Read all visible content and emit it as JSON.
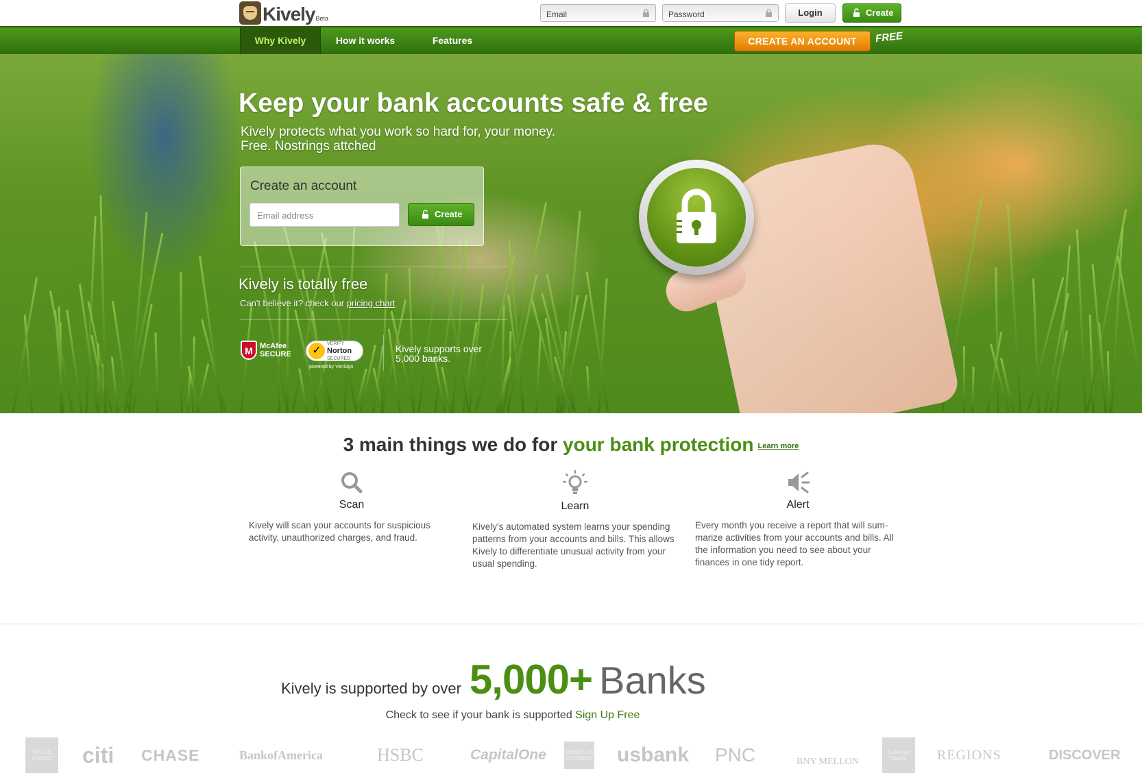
{
  "topbar": {
    "logo_text": "Kively",
    "logo_beta": "Beta",
    "email_placeholder": "Email",
    "password_placeholder": "Password",
    "login_label": "Login",
    "create_label": "Create"
  },
  "nav": {
    "items": [
      {
        "label": "Why Kively",
        "active": true
      },
      {
        "label": "How it works",
        "active": false
      },
      {
        "label": "Features",
        "active": false
      }
    ],
    "create_account_label": "CREATE AN ACCOUNT",
    "free_tag": "FREE"
  },
  "hero": {
    "title": "Keep your bank accounts safe & free",
    "subtitle_line1": "Kively protects what you work so hard for, your money.",
    "subtitle_line2": "Free. Nostrings attched",
    "create_box": {
      "title": "Create an account",
      "email_placeholder": "Email address",
      "create_label": "Create"
    },
    "free_title": "Kively is totally free",
    "free_sub_prefix": "Can't believe it? check our ",
    "pricing_link": "pricing chart",
    "mcafee_line1": "McAfee",
    "mcafee_line2": "SECURE",
    "norton_verify": "VERIFY",
    "norton_line1": "Norton",
    "norton_line2": "SECURED",
    "norton_powered": "powered by VeriSign",
    "supports_text": "Kively supports over 5,000 banks."
  },
  "section_features": {
    "title_plain": "3 main things we do for ",
    "title_green": "your bank protection",
    "learn_more": "Learn more",
    "features": [
      {
        "icon": "search-icon",
        "title": "Scan",
        "desc": "Kively will scan your accounts for suspicious activity, unauthorized charges, and fraud."
      },
      {
        "icon": "lightbulb-icon",
        "title": "Learn",
        "desc": "Kively's automated system learns your spending patterns from your accounts and bills. This allows Kively to differentiate unusual activity from your usual spending."
      },
      {
        "icon": "speaker-icon",
        "title": "Alert",
        "desc": "Every month you receive a report that will sum-marize activities from your accounts and bills. All the information you need to see about your finances in one tidy report."
      }
    ]
  },
  "section_banks": {
    "supported_text": "Kively is supported by over",
    "number": "5,000+",
    "banks_word": "Banks",
    "check_text": "Check to see if your bank is supported ",
    "signup_link": "Sign Up Free",
    "bank_logos": [
      "WELLS FARGO",
      "citi",
      "CHASE",
      "BankofAmerica",
      "HSBC",
      "CapitalOne",
      "AMERICAN EXPRESS",
      "usbank",
      "PNC",
      "BNY MELLON",
      "Goldman Sachs",
      "REGIONS",
      "DISCOVER"
    ]
  },
  "colors": {
    "brand_green": "#4a8f14",
    "nav_green": "#3c8314",
    "cta_orange": "#f29a12"
  }
}
